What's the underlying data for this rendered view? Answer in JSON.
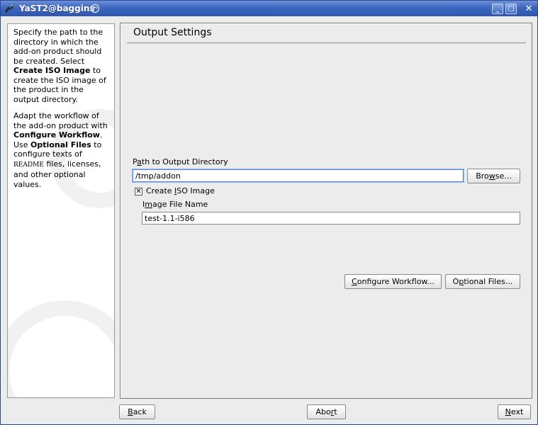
{
  "window": {
    "title": "YaST2@baggins",
    "minimize_glyph": "_",
    "maximize_glyph": "□",
    "close_glyph": "✕"
  },
  "help": {
    "p1": [
      "Specify the path to the directory in which the add-on product should be created. Select ",
      "Create ISO Image",
      " to create the ISO image of the product in the output directory."
    ],
    "p2": [
      "Adapt the workflow of the add-on product with ",
      "Configure Workflow",
      ". Use ",
      "Optional Files",
      " to configure texts of ",
      "README",
      " files, licenses, and other optional values."
    ]
  },
  "content": {
    "title": "Output Settings",
    "output_dir": {
      "label_pre": "P",
      "label_mnemonic": "a",
      "label_post": "th to Output Directory",
      "value": "/tmp/addon"
    },
    "browse_button": {
      "pre": "Bro",
      "mnemonic": "w",
      "post": "se..."
    },
    "create_iso": {
      "checked": true,
      "check_glyph": "✕",
      "label_pre": "Create ",
      "label_mnemonic": "I",
      "label_post": "SO Image"
    },
    "image_name": {
      "label_pre": "I",
      "label_mnemonic": "m",
      "label_post": "age File Name",
      "value": "test-1.1-i586"
    },
    "configure_workflow_button": {
      "pre": "",
      "mnemonic": "C",
      "post": "onfigure Workflow..."
    },
    "optional_files_button": {
      "pre": "O",
      "mnemonic": "p",
      "post": "tional Files..."
    }
  },
  "footer": {
    "back_button": {
      "pre": "",
      "mnemonic": "B",
      "post": "ack"
    },
    "abort_button": {
      "pre": "Abo",
      "mnemonic": "r",
      "post": "t"
    },
    "next_button": {
      "pre": "",
      "mnemonic": "N",
      "post": "ext"
    }
  }
}
